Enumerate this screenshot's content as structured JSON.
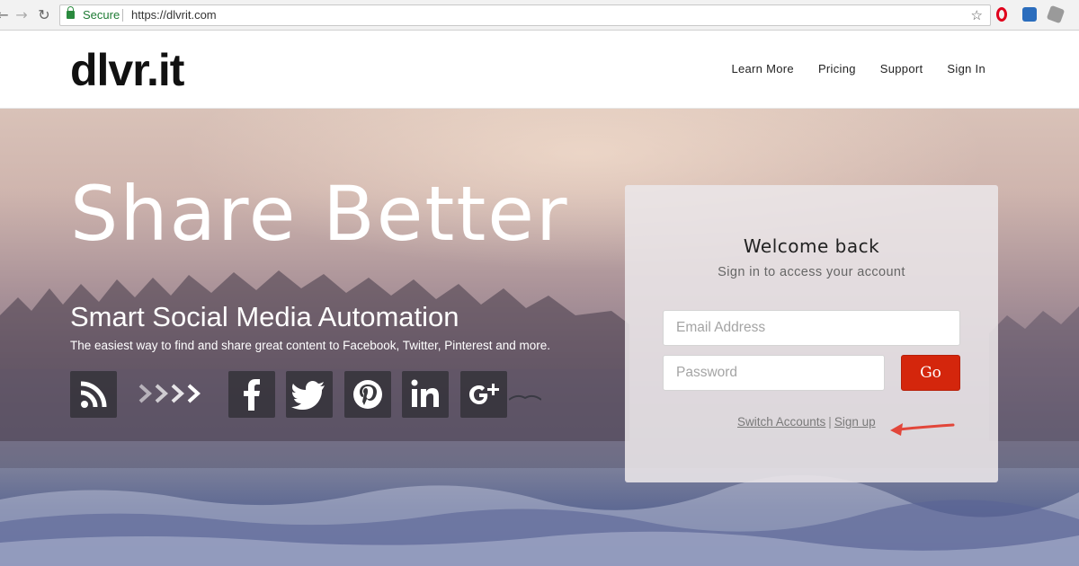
{
  "browser": {
    "back_icon": "back-arrow-icon",
    "forward_icon": "forward-arrow-icon",
    "reload_icon": "reload-icon",
    "secure_label": "Secure",
    "url": "https://dlvrit.com",
    "bookmark_icon": "star-icon",
    "extensions": [
      "opera-icon",
      "extension-icon",
      "extension-icon"
    ]
  },
  "header": {
    "logo": "dlvr.it",
    "menu": [
      "Learn More",
      "Pricing",
      "Support",
      "Sign In"
    ]
  },
  "hero": {
    "headline": "Share Better",
    "subheadline": "Smart Social Media Automation",
    "tagline": "The easiest way to find and share great content to Facebook, Twitter, Pinterest and more.",
    "icons": [
      "rss-icon",
      "chevrons-icon",
      "facebook-icon",
      "twitter-icon",
      "pinterest-icon",
      "linkedin-icon",
      "google-plus-icon"
    ]
  },
  "signin": {
    "title": "Welcome back",
    "subtitle": "Sign in to access your account",
    "email_placeholder": "Email Address",
    "password_placeholder": "Password",
    "submit_label": "Go",
    "switch_label": "Switch Accounts",
    "separator": "|",
    "signup_label": "Sign up"
  },
  "colors": {
    "go_button": "#d4260c",
    "secure_green": "#1e7b34",
    "annotation_arrow": "#e2463a"
  }
}
